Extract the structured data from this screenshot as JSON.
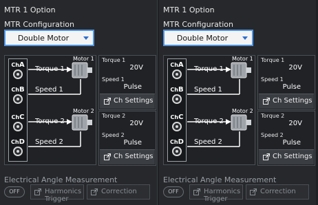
{
  "panels": [
    {
      "title": "MTR 1 Option",
      "config_label": "MTR Configuration",
      "config_value": "Double Motor",
      "channels": [
        {
          "prefix": "Ch",
          "letter": "A"
        },
        {
          "prefix": "Ch",
          "letter": "B"
        },
        {
          "prefix": "Ch",
          "letter": "C"
        },
        {
          "prefix": "Ch",
          "letter": "D"
        }
      ],
      "signals": [
        "Torque 1",
        "Speed 1",
        "Torque 2",
        "Speed 2"
      ],
      "motors": [
        "Motor 1",
        "Motor 2"
      ],
      "cards": [
        {
          "title": "Torque 1",
          "value": "20V",
          "sub_label": "Speed 1",
          "sub_value": "Pulse",
          "button": "Ch Settings"
        },
        {
          "title": "Torque 2",
          "value": "20V",
          "sub_label": "Speed 2",
          "sub_value": "Pulse",
          "button": "Ch Settings"
        }
      ],
      "electrical_label": "Electrical Angle Measurement",
      "toggle": "OFF",
      "harmonics_button": "Harmonics Trigger",
      "correction_button": "Correction"
    },
    {
      "title": "MTR 1 Option",
      "config_label": "MTR Configuration",
      "config_value": "Double Motor",
      "channels": [
        {
          "prefix": "Ch",
          "letter": "A"
        },
        {
          "prefix": "Ch",
          "letter": "B"
        },
        {
          "prefix": "Ch",
          "letter": "C"
        },
        {
          "prefix": "Ch",
          "letter": "D"
        }
      ],
      "signals": [
        "Torque 1",
        "Speed 1",
        "Torque 2",
        "Speed 2"
      ],
      "motors": [
        "Motor 1",
        "Motor 2"
      ],
      "cards": [
        {
          "title": "Torque 1",
          "value": "20V",
          "sub_label": "Speed 1",
          "sub_value": "Pulse",
          "button": "Ch Settings"
        },
        {
          "title": "Torque 2",
          "value": "20V",
          "sub_label": "Speed 2",
          "sub_value": "Pulse",
          "button": "Ch Settings"
        }
      ],
      "electrical_label": "Electrical Angle Measurement",
      "toggle": "OFF",
      "harmonics_button": "Harmonics Trigger",
      "correction_button": "Correction"
    }
  ],
  "colors": {
    "background": "#26282c",
    "dropdown_border": "#4e95e8",
    "wire": "#ffffff",
    "disabled_text": "#8a8e94"
  },
  "icons": {
    "dropdown": "chevron-down-icon",
    "channel_connector": "bnc-connector-icon",
    "motor": "motor-icon",
    "settings_button": "external-link-icon",
    "toggle": "toggle-off-icon"
  }
}
